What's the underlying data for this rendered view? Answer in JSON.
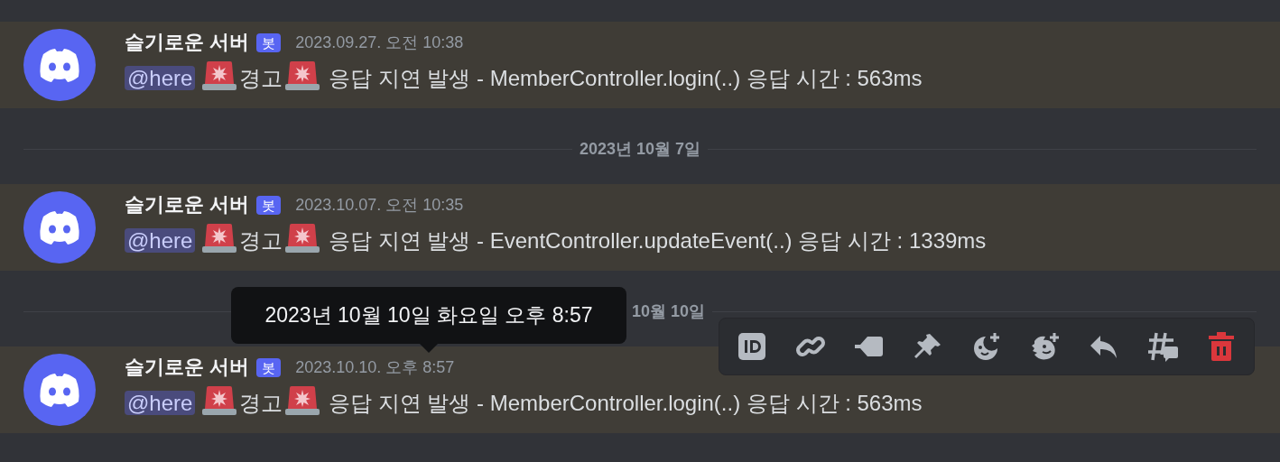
{
  "messages": [
    {
      "kind": "message",
      "author": "슬기로운 서버",
      "badge": "봇",
      "timestamp": "2023.09.27. 오전 10:38",
      "hovered": false,
      "segments": [
        {
          "kind": "mention",
          "text": "@here"
        },
        {
          "kind": "siren"
        },
        {
          "kind": "text",
          "text": "경고"
        },
        {
          "kind": "siren"
        },
        {
          "kind": "text",
          "text": " 응답 지연 발생 - MemberController.login(..) 응답 시간 : 563ms"
        }
      ]
    },
    {
      "kind": "divider",
      "text": "2023년 10월 7일"
    },
    {
      "kind": "message",
      "author": "슬기로운 서버",
      "badge": "봇",
      "timestamp": "2023.10.07. 오전 10:35",
      "hovered": false,
      "segments": [
        {
          "kind": "mention",
          "text": "@here"
        },
        {
          "kind": "siren"
        },
        {
          "kind": "text",
          "text": "경고"
        },
        {
          "kind": "siren"
        },
        {
          "kind": "text",
          "text": " 응답 지연 발생 - EventController.updateEvent(..) 응답 시간 : 1339ms"
        }
      ]
    },
    {
      "kind": "divider",
      "text": "10월 10일"
    },
    {
      "kind": "message",
      "author": "슬기로운 서버",
      "badge": "봇",
      "timestamp": "2023.10.10. 오후 8:57",
      "hovered": true,
      "tooltip": "2023년 10월 10일 화요일 오후 8:57",
      "segments": [
        {
          "kind": "mention",
          "text": "@here"
        },
        {
          "kind": "siren"
        },
        {
          "kind": "text",
          "text": "경고"
        },
        {
          "kind": "siren"
        },
        {
          "kind": "text",
          "text": " 응답 지연 발생 - MemberController.login(..) 응답 시간 : 563ms"
        }
      ]
    }
  ]
}
